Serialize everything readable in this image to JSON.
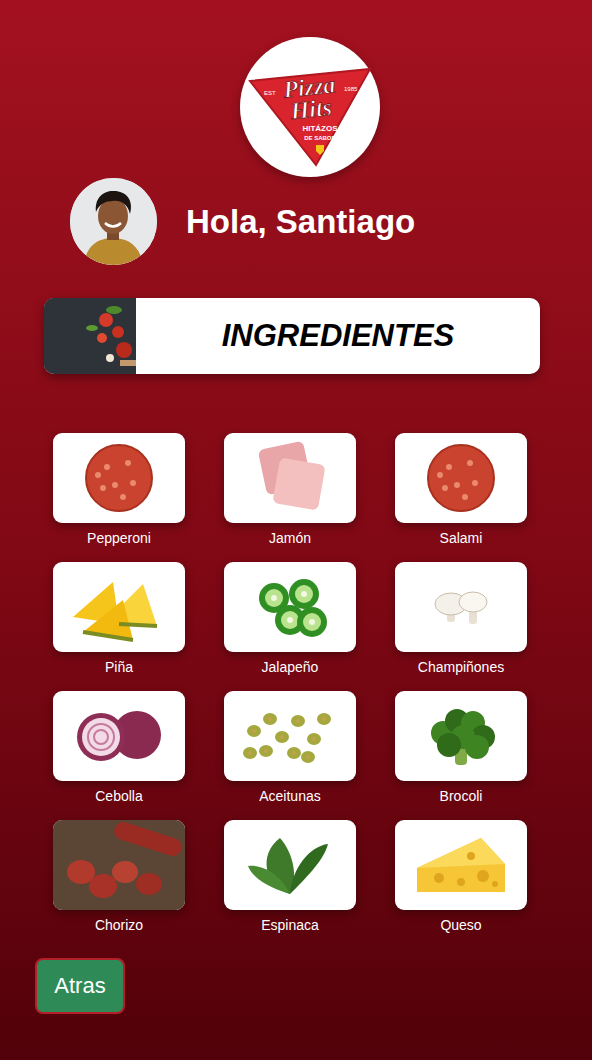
{
  "logo": {
    "lines": [
      "Pizza",
      "Hits"
    ],
    "tagline": [
      "HITÁZOS",
      "DE SABOR"
    ],
    "est": "EST",
    "year": "1985"
  },
  "user": {
    "greeting": "Hola, Santiago"
  },
  "section": {
    "title": "INGREDIENTES"
  },
  "ingredients": [
    {
      "name": "Pepperoni"
    },
    {
      "name": "Jamón"
    },
    {
      "name": "Salami"
    },
    {
      "name": "Piña"
    },
    {
      "name": "Jalapeño"
    },
    {
      "name": "Champiñones"
    },
    {
      "name": "Cebolla"
    },
    {
      "name": "Aceitunas"
    },
    {
      "name": "Brocoli"
    },
    {
      "name": "Chorizo"
    },
    {
      "name": "Espinaca"
    },
    {
      "name": "Queso"
    }
  ],
  "back_button": {
    "label": "Atras"
  }
}
